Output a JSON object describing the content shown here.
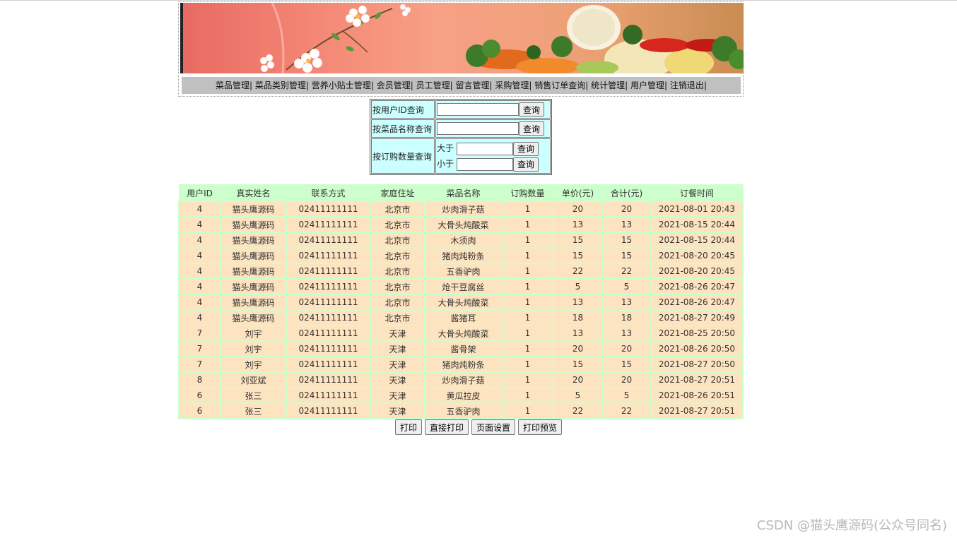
{
  "nav": {
    "items": [
      "菜品管理",
      "菜品类别管理",
      "营养小贴士管理",
      "会员管理",
      "员工管理",
      "留言管理",
      "采购管理",
      "销售订单查询",
      "统计管理",
      "用户管理",
      "注销退出"
    ],
    "separator": "|"
  },
  "query": {
    "by_user_id_label": "按用户ID查询",
    "by_dish_name_label": "按菜品名称查询",
    "by_quantity_label": "按订购数量查询",
    "greater_than_label": "大于",
    "less_than_label": "小于",
    "button_label": "查询"
  },
  "orders": {
    "headers": [
      "用户ID",
      "真实姓名",
      "联系方式",
      "家庭住址",
      "菜品名称",
      "订购数量",
      "单价(元)",
      "合计(元)",
      "订餐时间"
    ],
    "rows": [
      [
        "4",
        "猫头鹰源码",
        "02411111111",
        "北京市",
        "炒肉滑子菇",
        "1",
        "20",
        "20",
        "2021-08-01 20:43"
      ],
      [
        "4",
        "猫头鹰源码",
        "02411111111",
        "北京市",
        "大骨头炖酸菜",
        "1",
        "13",
        "13",
        "2021-08-15 20:44"
      ],
      [
        "4",
        "猫头鹰源码",
        "02411111111",
        "北京市",
        "木须肉",
        "1",
        "15",
        "15",
        "2021-08-15 20:44"
      ],
      [
        "4",
        "猫头鹰源码",
        "02411111111",
        "北京市",
        "猪肉炖粉条",
        "1",
        "15",
        "15",
        "2021-08-20 20:45"
      ],
      [
        "4",
        "猫头鹰源码",
        "02411111111",
        "北京市",
        "五香驴肉",
        "1",
        "22",
        "22",
        "2021-08-20 20:45"
      ],
      [
        "4",
        "猫头鹰源码",
        "02411111111",
        "北京市",
        "炝干豆腐丝",
        "1",
        "5",
        "5",
        "2021-08-26 20:47"
      ],
      [
        "4",
        "猫头鹰源码",
        "02411111111",
        "北京市",
        "大骨头炖酸菜",
        "1",
        "13",
        "13",
        "2021-08-26 20:47"
      ],
      [
        "4",
        "猫头鹰源码",
        "02411111111",
        "北京市",
        "酱猪耳",
        "1",
        "18",
        "18",
        "2021-08-27 20:49"
      ],
      [
        "7",
        "刘宇",
        "02411111111",
        "天津",
        "大骨头炖酸菜",
        "1",
        "13",
        "13",
        "2021-08-25 20:50"
      ],
      [
        "7",
        "刘宇",
        "02411111111",
        "天津",
        "酱骨架",
        "1",
        "20",
        "20",
        "2021-08-26 20:50"
      ],
      [
        "7",
        "刘宇",
        "02411111111",
        "天津",
        "猪肉炖粉条",
        "1",
        "15",
        "15",
        "2021-08-27 20:50"
      ],
      [
        "8",
        "刘亚斌",
        "02411111111",
        "天津",
        "炒肉滑子菇",
        "1",
        "20",
        "20",
        "2021-08-27 20:51"
      ],
      [
        "6",
        "张三",
        "02411111111",
        "天津",
        "黄瓜拉皮",
        "1",
        "5",
        "5",
        "2021-08-26 20:51"
      ],
      [
        "6",
        "张三",
        "02411111111",
        "天津",
        "五香驴肉",
        "1",
        "22",
        "22",
        "2021-08-27 20:51"
      ]
    ]
  },
  "print": {
    "print_label": "打印",
    "direct_print_label": "直接打印",
    "page_setup_label": "页面设置",
    "print_preview_label": "打印预览"
  },
  "watermark": "CSDN @猫头鹰源码(公众号同名)",
  "colors": {
    "nav_bg": "#c0c0c0",
    "query_bg": "#ccffff",
    "header_bg": "#ccffcc",
    "row_bg": "#fde3c0"
  }
}
